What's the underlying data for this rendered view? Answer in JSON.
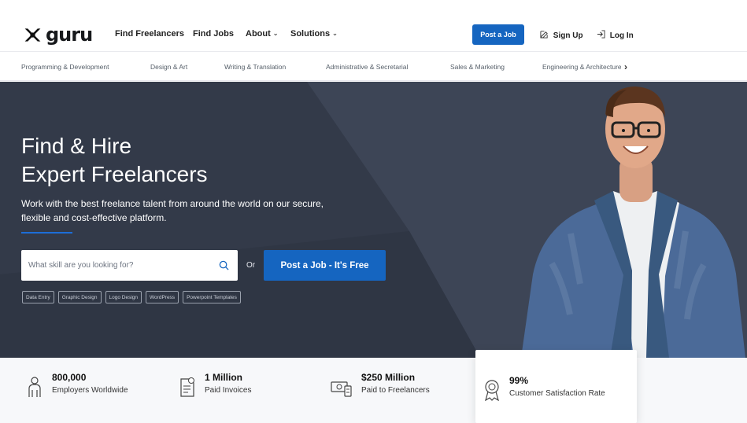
{
  "nav": {
    "brand": "guru",
    "links": [
      "Find Freelancers",
      "Find Jobs",
      "About",
      "Solutions"
    ],
    "post_job": "Post a Job",
    "sign_up": "Sign Up",
    "log_in": "Log In"
  },
  "categories": [
    "Programming & Development",
    "Design & Art",
    "Writing & Translation",
    "Administrative & Secretarial",
    "Sales & Marketing",
    "Engineering & Architecture"
  ],
  "hero": {
    "title_line_1": "Find & Hire",
    "title_line_2": "Expert Freelancers",
    "subtitle": "Work with the best freelance talent from around the world on our secure, flexible and cost-effective platform.",
    "search": {
      "placeholder": "What skill are you looking for?"
    },
    "or": "Or",
    "post_job_free": "Post a Job - It's Free",
    "tags": [
      "Data Entry",
      "Graphic Design",
      "Logo Design",
      "WordPress",
      "Powerpoint Templates"
    ]
  },
  "stats": [
    {
      "value": "800,000",
      "label": "Employers Worldwide",
      "icon": "employer-icon"
    },
    {
      "value": "1 Million",
      "label": "Paid Invoices",
      "icon": "invoice-icon"
    },
    {
      "value": "$250 Million",
      "label": "Paid to Freelancers",
      "icon": "money-icon"
    },
    {
      "value": "99%",
      "label": "Customer Satisfaction Rate",
      "icon": "award-icon"
    }
  ],
  "colors": {
    "primary": "#1565c0",
    "hero_bg": "#333a49",
    "stats_bg": "#f7f8fa"
  }
}
